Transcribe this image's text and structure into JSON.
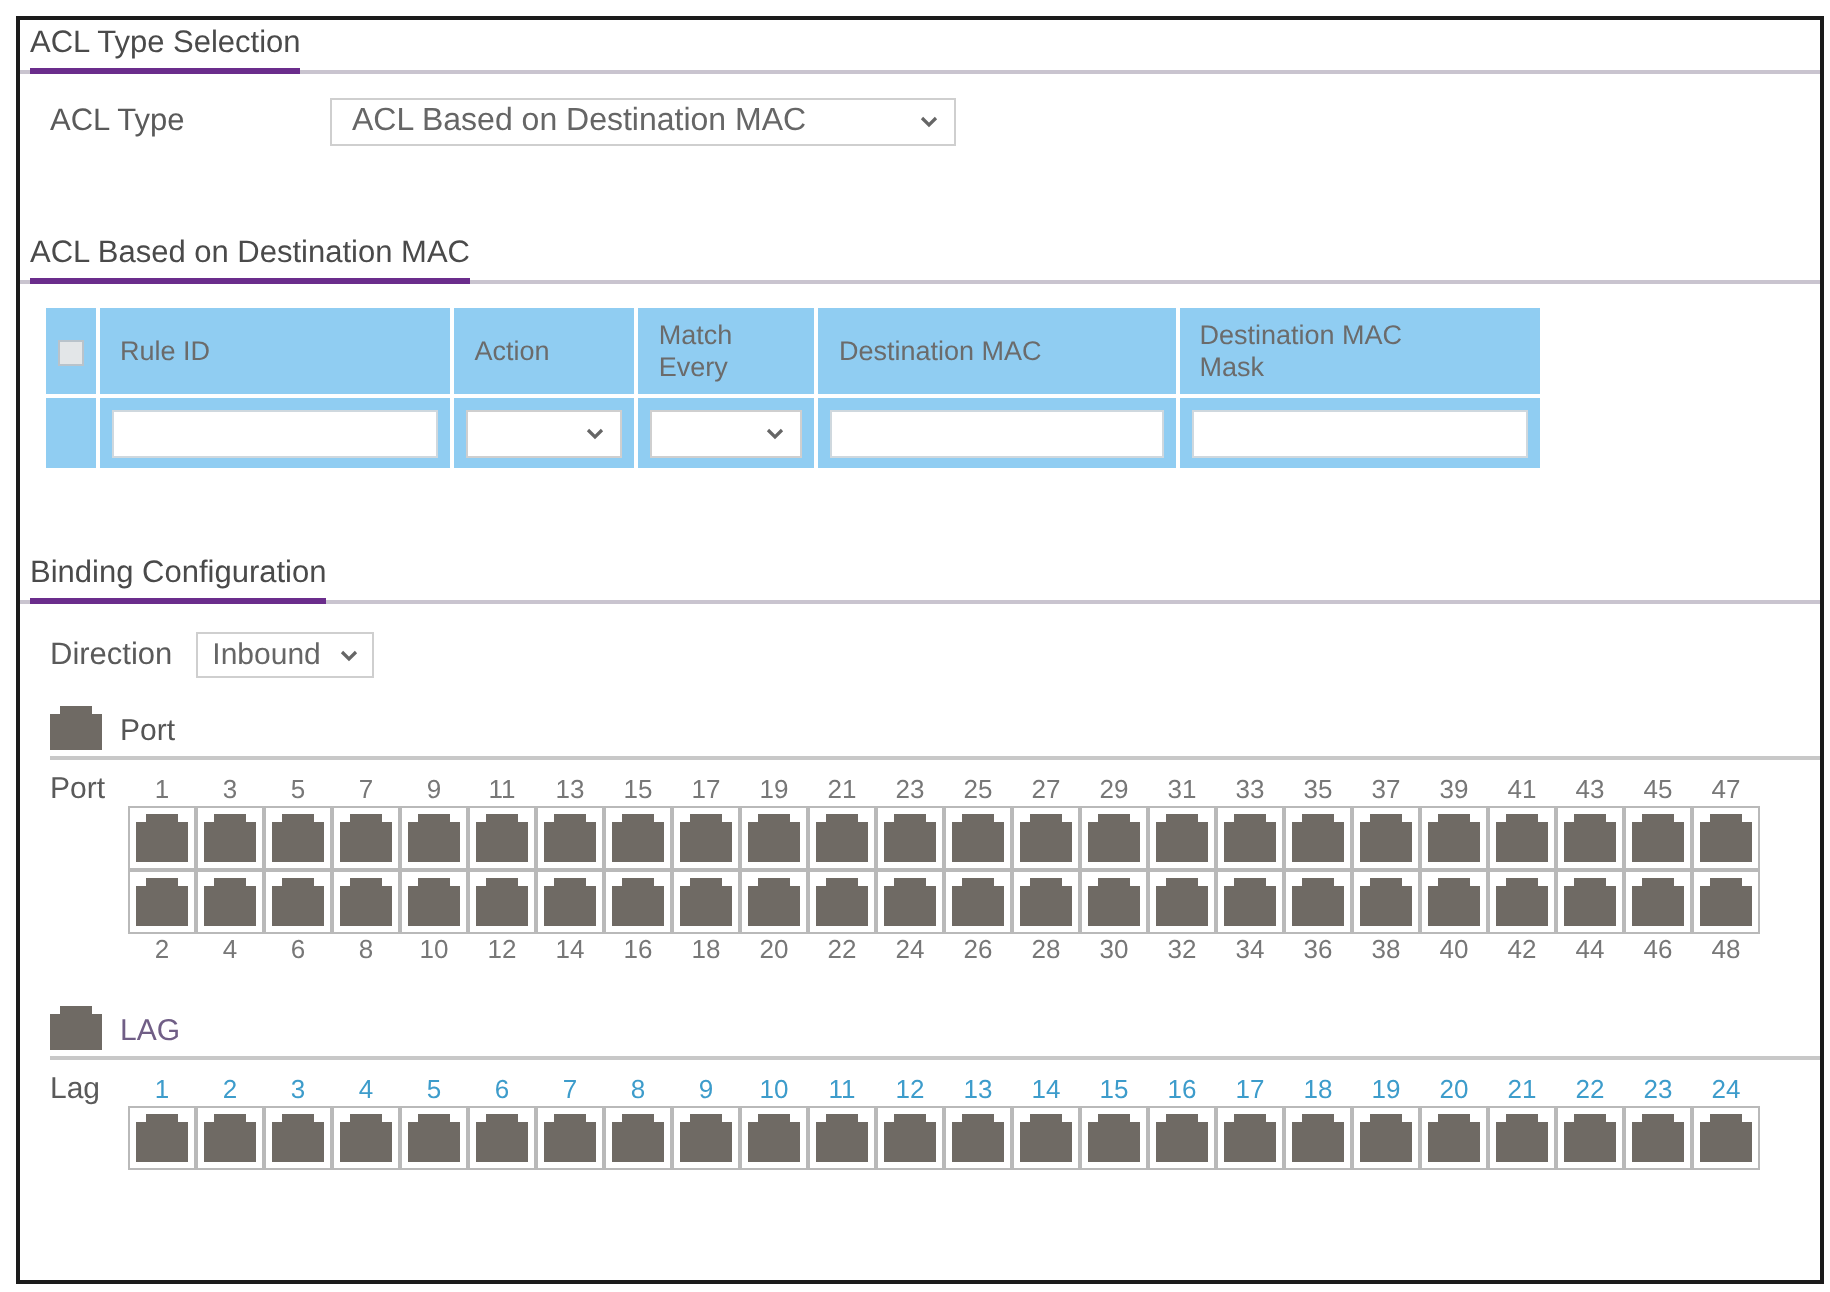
{
  "acl_type_selection": {
    "heading": "ACL Type Selection",
    "acl_type": {
      "label": "ACL Type",
      "value": "ACL Based on Destination MAC"
    }
  },
  "acl_rules": {
    "heading": "ACL Based on Destination MAC",
    "select_all": {
      "checked": false
    },
    "columns": [
      {
        "label": "Rule ID",
        "kind": "text"
      },
      {
        "label": "Action",
        "kind": "select"
      },
      {
        "label": "Match Every",
        "kind": "select"
      },
      {
        "label": "Destination MAC",
        "kind": "text"
      },
      {
        "label": "Destination MAC Mask",
        "kind": "text"
      }
    ]
  },
  "binding": {
    "heading": "Binding Configuration",
    "direction": {
      "label": "Direction",
      "value": "Inbound"
    },
    "groups": [
      {
        "kind": "port",
        "title": "Port",
        "row_label": "Port",
        "ports": [
          "1",
          "2",
          "3",
          "4",
          "5",
          "6",
          "7",
          "8",
          "9",
          "10",
          "11",
          "12",
          "13",
          "14",
          "15",
          "16",
          "17",
          "18",
          "19",
          "20",
          "21",
          "22",
          "23",
          "24",
          "25",
          "26",
          "27",
          "28",
          "29",
          "30",
          "31",
          "32",
          "33",
          "34",
          "35",
          "36",
          "37",
          "38",
          "39",
          "40",
          "41",
          "42",
          "43",
          "44",
          "45",
          "46",
          "47",
          "48"
        ]
      },
      {
        "kind": "lag",
        "title": "LAG",
        "row_label": "Lag",
        "ports": [
          "1",
          "2",
          "3",
          "4",
          "5",
          "6",
          "7",
          "8",
          "9",
          "10",
          "11",
          "12",
          "13",
          "14",
          "15",
          "16",
          "17",
          "18",
          "19",
          "20",
          "21",
          "22",
          "23",
          "24"
        ]
      }
    ]
  }
}
